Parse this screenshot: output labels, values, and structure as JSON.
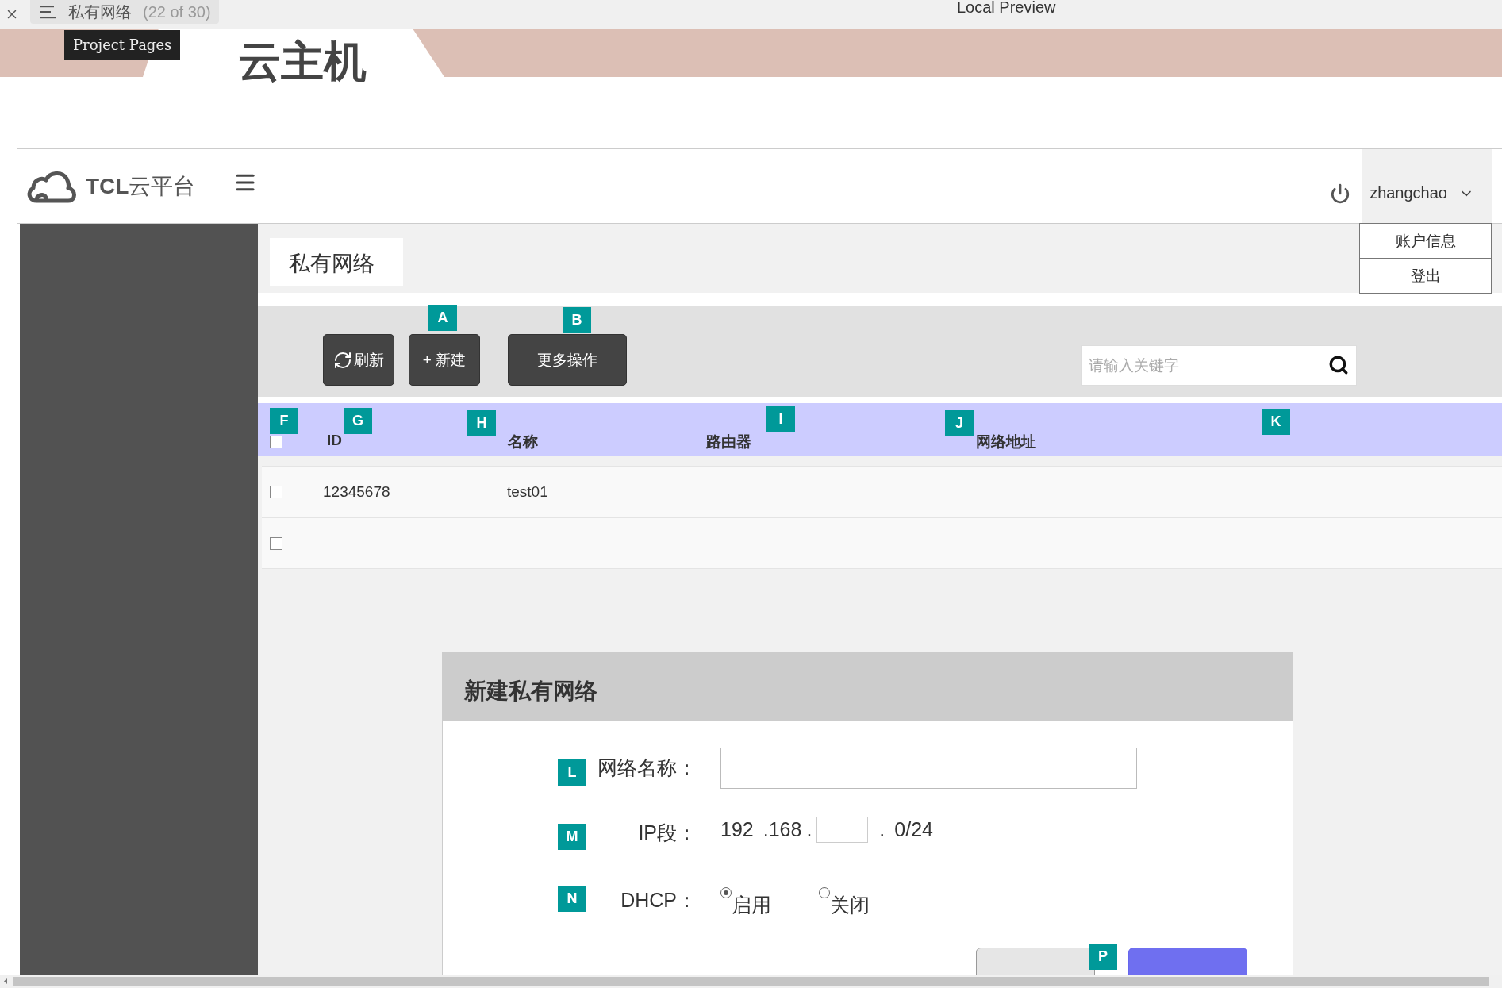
{
  "browser_bar": {
    "page_title": "私有网络",
    "page_count": "(22 of 30)",
    "preview_label": "Local Preview"
  },
  "banner": {
    "tooltip": "Project Pages",
    "title": "云主机"
  },
  "header": {
    "logo": "**TCL**云平台",
    "user": "zhangchao",
    "user_menu": [
      {
        "label": "账户信息"
      },
      {
        "label": "登出"
      }
    ]
  },
  "page_title": "私有网络",
  "toolbar": {
    "buttons": [
      {
        "label": "刷新",
        "kind": "refresh"
      },
      {
        "label": "+ 新建",
        "kind": "plain"
      },
      {
        "label": "更多操作",
        "kind": "plain"
      }
    ],
    "search": {
      "placeholder": "请输入关键字"
    }
  },
  "table": {
    "columns": [
      "ID",
      "名称",
      "路由器",
      "网络地址"
    ],
    "header_checked": false,
    "rows": [
      {
        "checked": false,
        "id": "12345678",
        "name": "test01"
      },
      {
        "checked": false
      }
    ]
  },
  "dialog": {
    "title": "新建私有网络",
    "fields": [
      {
        "kind": "text",
        "label": "网络名称："
      },
      {
        "kind": "ip",
        "label": "IP段：",
        "before_box": [
          "192",
          ".168",
          "."
        ],
        "after_box": [
          ".",
          "0/24"
        ]
      },
      {
        "kind": "radio",
        "label": "DHCP：",
        "options": [
          {
            "label": "启用",
            "selected": true
          },
          {
            "label": "关闭",
            "selected": false
          }
        ]
      }
    ]
  },
  "annotations": [
    {
      "label": "A"
    },
    {
      "label": "B"
    },
    {
      "label": "F"
    },
    {
      "label": "G"
    },
    {
      "label": "H"
    },
    {
      "label": "I"
    },
    {
      "label": "J"
    },
    {
      "label": "K"
    },
    {
      "label": "L"
    },
    {
      "label": "M"
    },
    {
      "label": "N"
    },
    {
      "label": "P"
    }
  ]
}
